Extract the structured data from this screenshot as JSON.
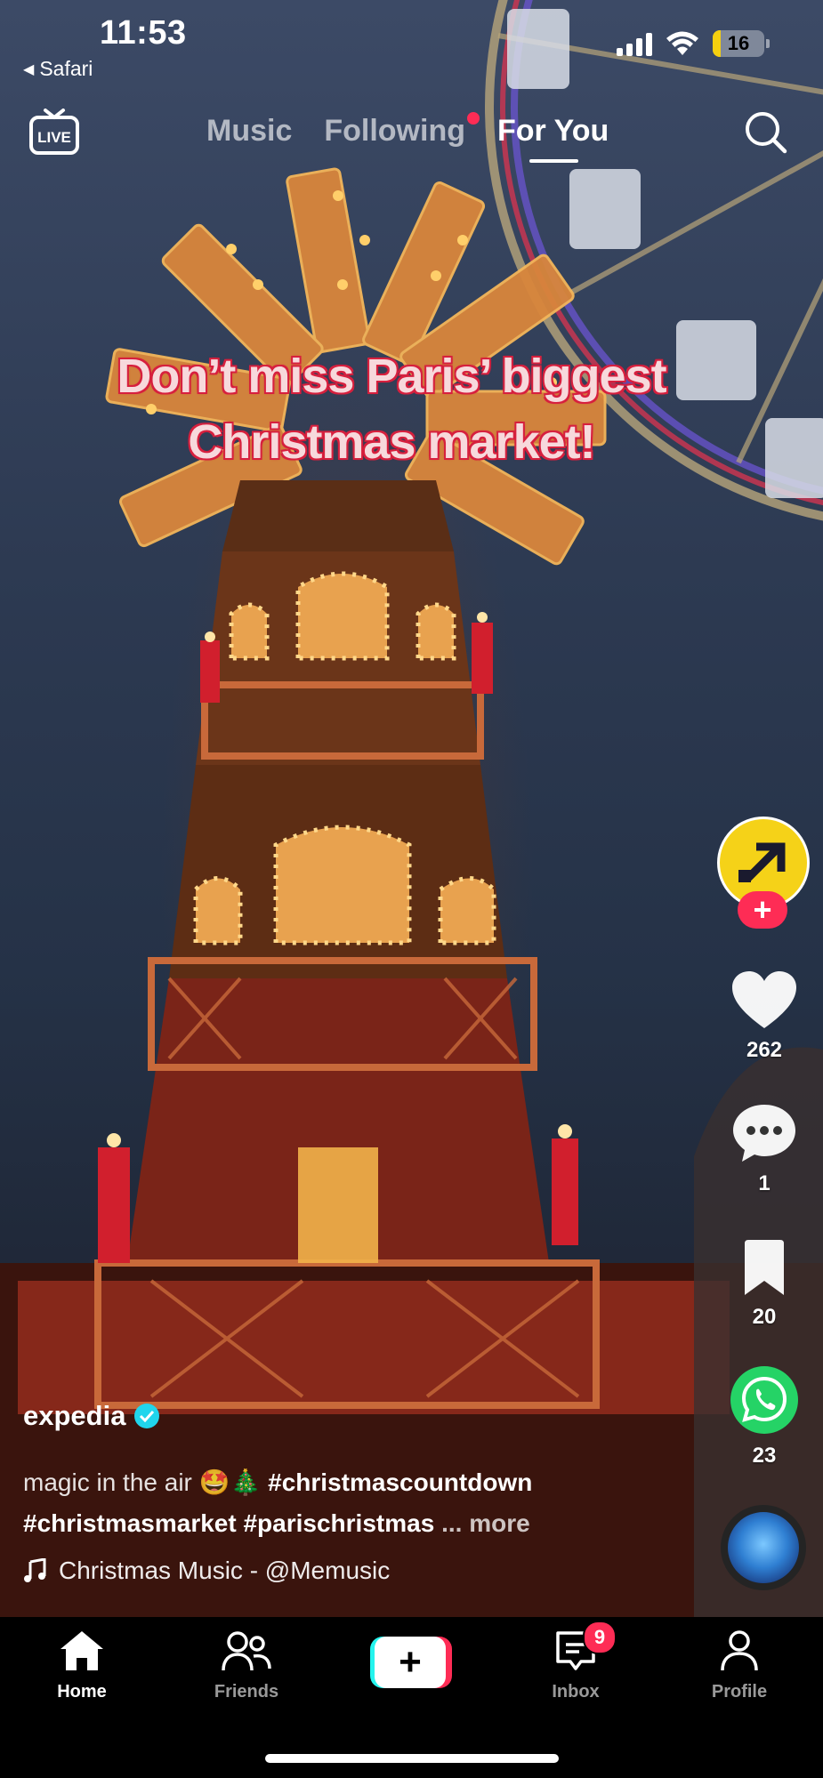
{
  "status_bar": {
    "time": "11:53",
    "back_app": "Safari",
    "battery": "16",
    "battery_level": 0.16
  },
  "top_nav": {
    "tabs": [
      {
        "label": "Music",
        "active": false
      },
      {
        "label": "Following",
        "active": false,
        "has_dot": true
      },
      {
        "label": "For You",
        "active": true
      }
    ],
    "live_label": "LIVE"
  },
  "video": {
    "overlay_line1": "Don’t miss Paris’ biggest",
    "overlay_line2": "Christmas market!"
  },
  "actions": {
    "likes": "262",
    "comments": "1",
    "bookmarks": "20",
    "shares": "23"
  },
  "post": {
    "username": "expedia",
    "desc_text": "magic in the air 🤩🎄",
    "hashtag1": "#christmascountdown",
    "hashtag2": "#christmasmarket",
    "hashtag3": "#parischristmas",
    "ellipsis": "...",
    "more": "more",
    "sound": "Christmas Music - @Memusic"
  },
  "bottom_nav": {
    "home": "Home",
    "friends": "Friends",
    "inbox": "Inbox",
    "inbox_badge": "9",
    "profile": "Profile"
  },
  "colors": {
    "accent_red": "#fe2c55",
    "accent_cyan": "#25f4ee",
    "brand_yellow": "#f5d218",
    "verified_blue": "#20d5ec",
    "whatsapp_green": "#25d366"
  }
}
